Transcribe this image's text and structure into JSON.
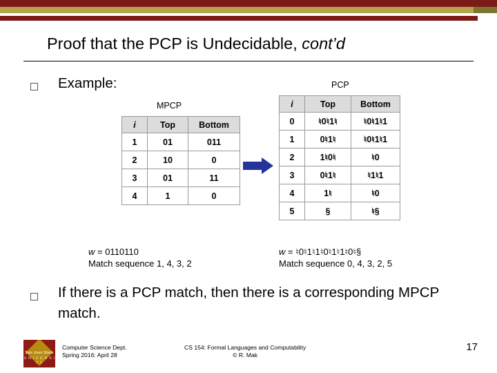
{
  "title": {
    "main": "Proof that the PCP is Undecidable, ",
    "italic": "cont’d"
  },
  "bullets": [
    {
      "label": "Example:"
    },
    {
      "label": "If there is a PCP match, then there is a corresponding MPCP match."
    }
  ],
  "mpcp": {
    "caption": "MPCP",
    "headers": [
      "i",
      "Top",
      "Bottom"
    ],
    "rows": [
      [
        "1",
        "01",
        "011"
      ],
      [
        "2",
        "10",
        "0"
      ],
      [
        "3",
        "01",
        "11"
      ],
      [
        "4",
        "1",
        "0"
      ]
    ],
    "note_w_label": "w",
    "note_w_value": " = 0110110",
    "note_match": "Match sequence 1, 4, 3, 2"
  },
  "pcp": {
    "caption": "PCP",
    "headers": [
      "i",
      "Top",
      "Bottom"
    ],
    "rows": [
      [
        "0",
        "♮0♮1♮",
        "♮0♮1♮1"
      ],
      [
        "1",
        "0♮1♮",
        "♮0♮1♮1"
      ],
      [
        "2",
        "1♮0♮",
        "♮0"
      ],
      [
        "3",
        "0♮1♮",
        "♮1♮1"
      ],
      [
        "4",
        "1♮",
        "♮0"
      ],
      [
        "5",
        "§",
        "♮§"
      ]
    ],
    "note_w_label": "w",
    "note_w_value": " = ♮0♮1♮1♮0♮1♮1♮0♮§",
    "note_match": "Match sequence 0, 4, 3, 2, 5"
  },
  "arrow": {
    "color": "#25349a"
  },
  "footer": {
    "logo_name": "San José State",
    "logo_univ": "U N I V E R S I T Y",
    "left_line1": "Computer Science Dept.",
    "left_line2": "Spring 2016: April 28",
    "mid_line1": "CS 154: Formal Languages and Computability",
    "mid_line2": "© R. Mak",
    "page": "17"
  },
  "colors": {
    "bar_maroon": "#7b1a16",
    "bar_gold": "#b6a44a",
    "header_gray": "#dcdcdc",
    "arrow_blue": "#25349a"
  }
}
